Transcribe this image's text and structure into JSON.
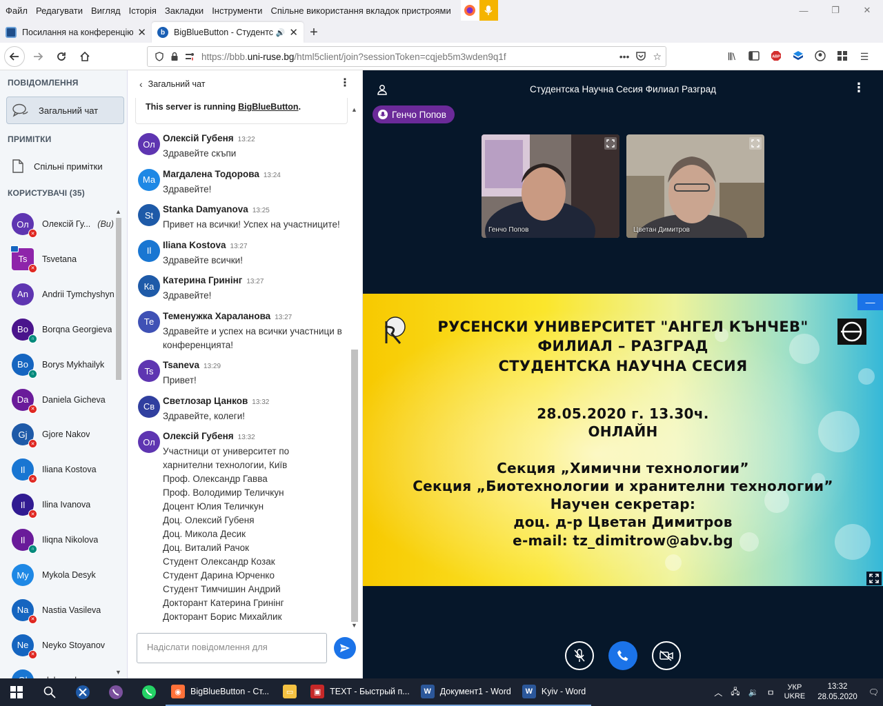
{
  "menubar": {
    "items": [
      "Файл",
      "Редагувати",
      "Вигляд",
      "Історія",
      "Закладки",
      "Інструменти",
      "Спільне використання вкладок пристроями"
    ]
  },
  "tabs": [
    {
      "title": "Посилання на конференцію з",
      "active": false
    },
    {
      "title": "BigBlueButton - Студентска",
      "active": true
    }
  ],
  "navbar": {
    "url_prefix": "https://bbb.",
    "url_domain": "uni-ruse.bg",
    "url_rest": "/html5client/join?sessionToken=cqjeb5m3wden9q1f"
  },
  "sidebar": {
    "messages_heading": "ПОВІДОМЛЕННЯ",
    "public_chat_label": "Загальний чат",
    "notes_heading": "ПРИМІТКИ",
    "shared_notes_label": "Спільні примітки",
    "users_heading": "КОРИСТУВАЧІ (35)"
  },
  "users": [
    {
      "initials": "Ол",
      "name": "Олексій Гу...",
      "suffix": "(Ви)",
      "color": "#5e35b1",
      "status": "muted",
      "shape": "round"
    },
    {
      "initials": "Ts",
      "name": "Tsvetana",
      "suffix": "",
      "color": "#8e24aa",
      "status": "muted",
      "shape": "square",
      "presenter": true
    },
    {
      "initials": "An",
      "name": "Andrii Tymchyshyn",
      "suffix": "",
      "color": "#5e35b1",
      "status": "none",
      "shape": "round"
    },
    {
      "initials": "Bo",
      "name": "Borqna Georgieva",
      "suffix": "",
      "color": "#4a148c",
      "status": "listen",
      "shape": "round"
    },
    {
      "initials": "Bo",
      "name": "Borys Mykhailyk",
      "suffix": "",
      "color": "#1565c0",
      "status": "listen",
      "shape": "round"
    },
    {
      "initials": "Da",
      "name": "Daniela Gicheva",
      "suffix": "",
      "color": "#6a1b9a",
      "status": "muted",
      "shape": "round"
    },
    {
      "initials": "Gj",
      "name": "Gjore Nakov",
      "suffix": "",
      "color": "#1e5aa8",
      "status": "muted",
      "shape": "round"
    },
    {
      "initials": "Il",
      "name": "Iliana Kostova",
      "suffix": "",
      "color": "#1976d2",
      "status": "muted",
      "shape": "round"
    },
    {
      "initials": "Il",
      "name": "Ilina Ivanova",
      "suffix": "",
      "color": "#311b92",
      "status": "muted",
      "shape": "round"
    },
    {
      "initials": "Il",
      "name": "Iliqna Nikolova",
      "suffix": "",
      "color": "#6a1b9a",
      "status": "listen",
      "shape": "round"
    },
    {
      "initials": "My",
      "name": "Mykola Desyk",
      "suffix": "",
      "color": "#1e88e5",
      "status": "none",
      "shape": "round"
    },
    {
      "initials": "Na",
      "name": "Nastia Vasileva",
      "suffix": "",
      "color": "#1565c0",
      "status": "muted",
      "shape": "round"
    },
    {
      "initials": "Ne",
      "name": "Neyko Stoyanov",
      "suffix": "",
      "color": "#1565c0",
      "status": "muted",
      "shape": "round"
    },
    {
      "initials": "Ol",
      "name": "oleksandr gavva",
      "suffix": "",
      "color": "#1976d2",
      "status": "none",
      "shape": "round"
    }
  ],
  "chat": {
    "title": "Загальний чат",
    "welcome_prefix": "This server is running ",
    "welcome_link": "BigBlueButton",
    "welcome_suffix": ".",
    "input_placeholder": "Надіслати повідомлення для",
    "messages": [
      {
        "initials": "Ол",
        "name": "Олексій Губеня",
        "time": "13:22",
        "color": "#5e35b1",
        "lines": [
          "Здравейте скъпи"
        ]
      },
      {
        "initials": "Ма",
        "name": "Магдалена Тодорова",
        "time": "13:24",
        "color": "#1e88e5",
        "lines": [
          "Здравейте!"
        ]
      },
      {
        "initials": "St",
        "name": "Stanka Damyanova",
        "time": "13:25",
        "color": "#1e5aa8",
        "lines": [
          "Привет на всички! Успех на участниците!"
        ]
      },
      {
        "initials": "Il",
        "name": "Iliana Kostova",
        "time": "13:27",
        "color": "#1976d2",
        "lines": [
          "Здравейте всички!"
        ]
      },
      {
        "initials": "Ка",
        "name": "Катерина Гринінг",
        "time": "13:27",
        "color": "#1e5aa8",
        "lines": [
          "Здравейте!"
        ]
      },
      {
        "initials": "Те",
        "name": "Теменужка Хараланова",
        "time": "13:27",
        "color": "#3f51b5",
        "lines": [
          "Здравейте и успех на всички участници в",
          "конференцията!"
        ]
      },
      {
        "initials": "Ts",
        "name": "Tsaneva",
        "time": "13:29",
        "color": "#5e35b1",
        "lines": [
          "Привет!"
        ]
      },
      {
        "initials": "Св",
        "name": "Светлозар Цанков",
        "time": "13:32",
        "color": "#303f9f",
        "lines": [
          "Здравейте, колеги!"
        ]
      },
      {
        "initials": "Ол",
        "name": "Олексій Губеня",
        "time": "13:32",
        "color": "#5e35b1",
        "lines": [
          "Участници от университет по",
          "харнителни технологии, Київ",
          "Проф. Олександр Гавва",
          "Проф. Володимир Теличкун",
          "Доцент Юлия Теличкун",
          "Доц. Олексий Губеня",
          "Доц. Микола Десик",
          "Доц. Виталий Рачок",
          "Студент Олександр Козак",
          "Студент Дарина Юрченко",
          "Студент Тимчишин Андрий",
          "Докторант Катерина Гринінг",
          "Докторант Борис Михайлик"
        ]
      }
    ]
  },
  "main": {
    "title": "Студентска Научна Сесия Филиал Разград",
    "talking": "Генчо Попов",
    "videos": [
      {
        "name": "Генчо Попов"
      },
      {
        "name": "Цветан Димитров"
      }
    ],
    "slide_lines": [
      "РУСЕНСКИ  УНИВЕРСИТЕТ \"АНГЕЛ КЪНЧЕВ\"",
      "ФИЛИАЛ – РАЗГРАД",
      "СТУДЕНТСКА НАУЧНА СЕСИЯ",
      "28.05.2020 г.  13.30ч.",
      "ОНЛАЙН",
      "Секция „Химични технологии”",
      "Секция „Биотехнологии и хранителни технологии”",
      "Научен секретар:",
      "доц. д-р Цветан Димитров",
      "e-mail: tz_dimitrow@abv.bg"
    ]
  },
  "taskbar": {
    "apps": [
      {
        "label": "BigBlueButton - Ст...",
        "color": "#ff7139",
        "glyph": "◉"
      },
      {
        "label": "",
        "color": "#f5c242",
        "glyph": "▭"
      },
      {
        "label": "TEXT - Быстрый п...",
        "color": "#c62828",
        "glyph": "▣"
      },
      {
        "label": "Документ1 - Word",
        "color": "#2b579a",
        "glyph": "W"
      },
      {
        "label": "Kyiv - Word",
        "color": "#2b579a",
        "glyph": "W"
      }
    ],
    "lang_top": "УКР",
    "lang_bottom": "UKRE",
    "time": "13:32",
    "date": "28.05.2020"
  }
}
